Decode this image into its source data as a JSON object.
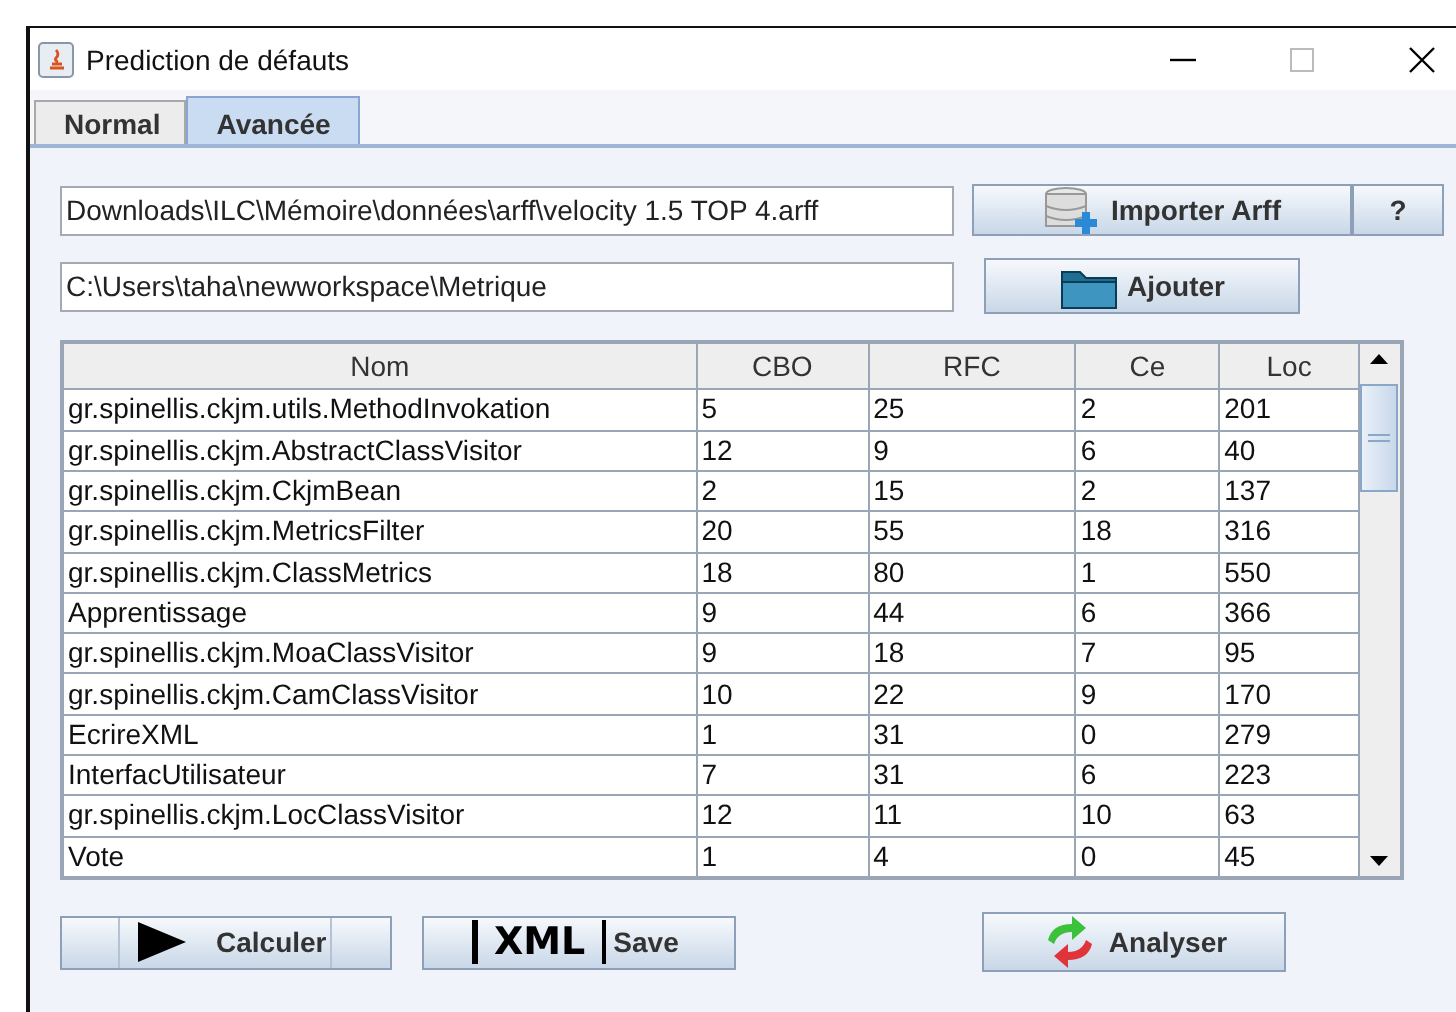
{
  "window": {
    "title": "Prediction de défauts"
  },
  "tabs": [
    {
      "label": "Normal",
      "selected": false
    },
    {
      "label": "Avancée",
      "selected": true
    }
  ],
  "arff_path": {
    "value": "Downloads\\ILC\\Mémoire\\données\\arff\\velocity 1.5 TOP 4.arff"
  },
  "import_button": {
    "label": "Importer Arff"
  },
  "help_button": {
    "label": "?"
  },
  "workspace_path": {
    "value": "C:\\Users\\taha\\newworkspace\\Metrique"
  },
  "add_button": {
    "label": "Ajouter"
  },
  "table": {
    "columns": [
      "Nom",
      "CBO",
      "RFC",
      "Ce",
      "Loc"
    ],
    "rows": [
      [
        "gr.spinellis.ckjm.utils.MethodInvokation",
        "5",
        "25",
        "2",
        "201"
      ],
      [
        "gr.spinellis.ckjm.AbstractClassVisitor",
        "12",
        "9",
        "6",
        "40"
      ],
      [
        "gr.spinellis.ckjm.CkjmBean",
        "2",
        "15",
        "2",
        "137"
      ],
      [
        "gr.spinellis.ckjm.MetricsFilter",
        "20",
        "55",
        "18",
        "316"
      ],
      [
        "gr.spinellis.ckjm.ClassMetrics",
        "18",
        "80",
        "1",
        "550"
      ],
      [
        "Apprentissage",
        "9",
        "44",
        "6",
        "366"
      ],
      [
        "gr.spinellis.ckjm.MoaClassVisitor",
        "9",
        "18",
        "7",
        "95"
      ],
      [
        "gr.spinellis.ckjm.CamClassVisitor",
        "10",
        "22",
        "9",
        "170"
      ],
      [
        "EcrireXML",
        "1",
        "31",
        "0",
        "279"
      ],
      [
        "InterfacUtilisateur",
        "7",
        "31",
        "6",
        "223"
      ],
      [
        "gr.spinellis.ckjm.LocClassVisitor",
        "12",
        "11",
        "10",
        "63"
      ],
      [
        "Vote",
        "1",
        "4",
        "0",
        "45"
      ]
    ]
  },
  "bottom_buttons": [
    {
      "kind": "play",
      "label": "Calculer"
    },
    {
      "kind": "xml",
      "badge": "XML",
      "label": "Save"
    },
    {
      "kind": "refresh",
      "label": "Analyser"
    }
  ]
}
